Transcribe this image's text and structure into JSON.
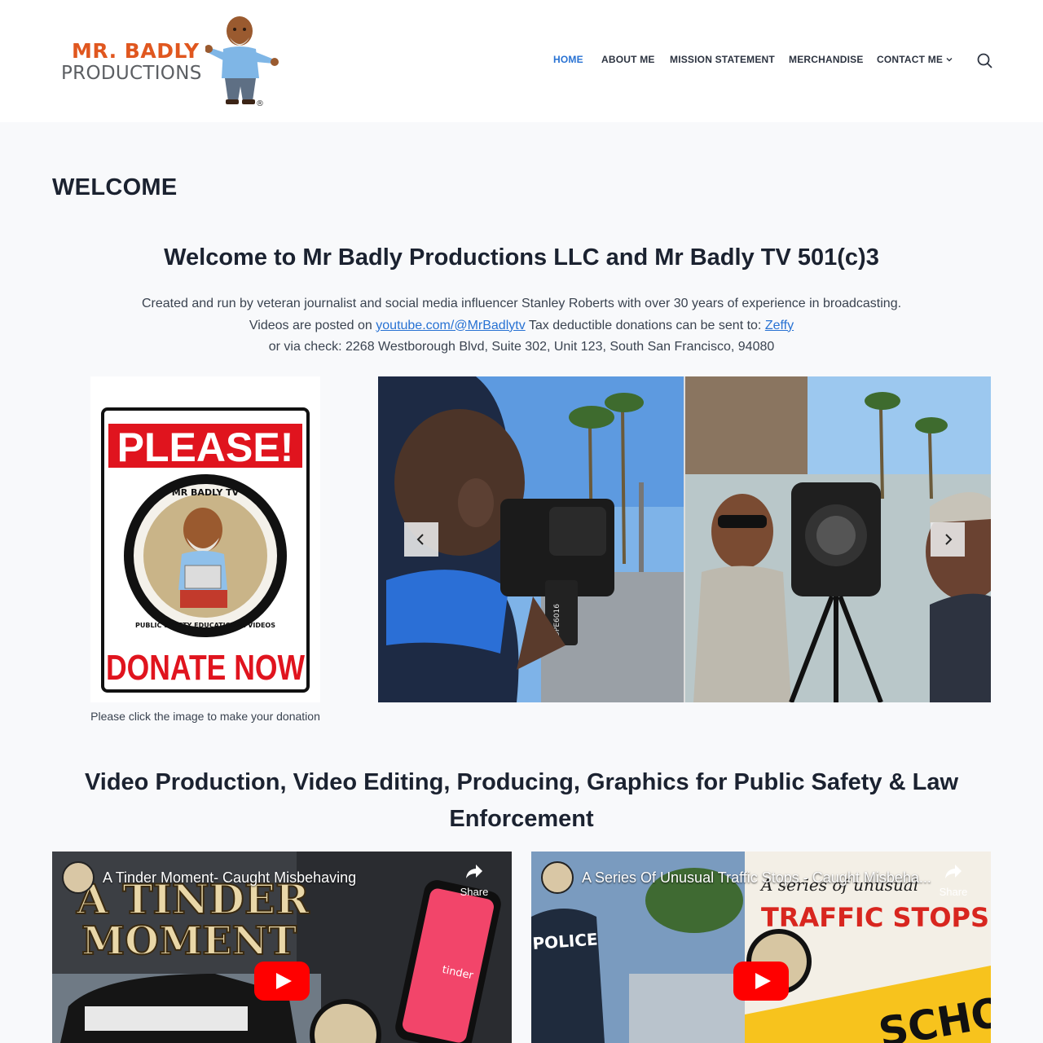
{
  "brand": {
    "logo_line1": "MR. BADLY",
    "logo_line2": "PRODUCTIONS",
    "registered_mark": "®"
  },
  "nav": {
    "items": [
      {
        "label": "HOME",
        "active": true
      },
      {
        "label": "ABOUT ME",
        "active": false
      },
      {
        "label": "MISSION STATEMENT",
        "active": false
      },
      {
        "label": "MERCHANDISE",
        "active": false
      },
      {
        "label": "CONTACT ME",
        "active": false
      }
    ],
    "contact_dropdown_icon": "chevron-down-icon",
    "search_icon": "search-icon"
  },
  "page": {
    "title": "WELCOME"
  },
  "hero": {
    "heading": "Welcome to Mr Badly Productions LLC and Mr Badly TV 501(c)3",
    "line1": "Created and run by veteran journalist and social media influencer Stanley Roberts with over 30 years of experience in broadcasting.",
    "line2_prefix": "Videos are posted on ",
    "youtube_link": "youtube.com/@MrBadlytv",
    "line2_middle": " Tax deductible donations can be sent to: ",
    "zeffy_link": "Zeffy",
    "line3": "or via check: 2268 Westborough Blvd, Suite 302, Unit 123, South San Francisco, 94080"
  },
  "donate": {
    "sign_top": "PLEASE!",
    "seal_top": "MR BADLY TV",
    "seal_bottom": "PUBLIC SAFETY EDUCATIONAL VIDEOS",
    "sign_bottom": "DONATE NOW",
    "caption": "Please click the image to make your donation"
  },
  "slider": {
    "prev_icon": "chevron-left-icon",
    "next_icon": "chevron-right-icon",
    "camera_label": "DPE6016"
  },
  "services": {
    "heading": "Video Production, Video Editing, Producing, Graphics for Public Safety & Law Enforcement"
  },
  "videos": [
    {
      "title": "A Tinder Moment- Caught Misbehaving",
      "share": "Share",
      "thumb_text_1": "A TINDER",
      "thumb_text_2": "MOMENT",
      "phone_text": "tinder"
    },
    {
      "title": "A Series Of Unusual Traffic Stops - Caught Misbeha...",
      "share": "Share",
      "thumb_text_1": "A series of unusual",
      "thumb_text_2": "TRAFFIC STOPS",
      "thumb_text_3": "SCHOOL BUS",
      "police_text": "POLICE"
    }
  ],
  "colors": {
    "accent": "#2872d3",
    "heading": "#1b2230",
    "logo_orange": "#e0571f",
    "donate_red": "#e0141e",
    "youtube_red": "#ff0000"
  }
}
